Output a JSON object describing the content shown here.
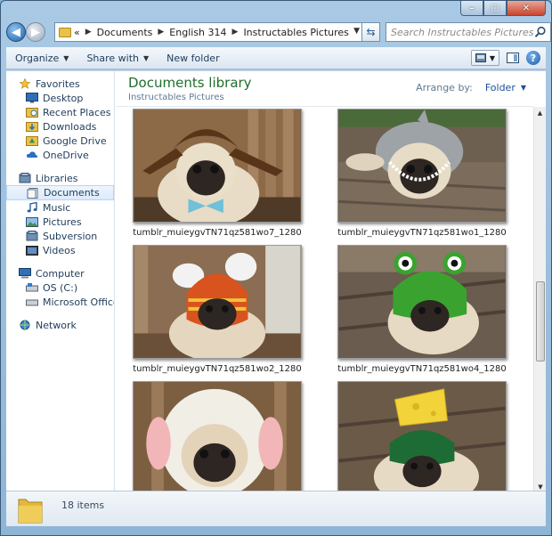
{
  "window": {
    "caption": {
      "minimize": "–",
      "maximize": "▢",
      "close": "✕"
    }
  },
  "address_bar": {
    "overflow_chevron": "«",
    "breadcrumbs": [
      "Documents",
      "English 314",
      "Instructables Pictures"
    ],
    "search_placeholder": "Search Instructables Pictures"
  },
  "toolbar": {
    "organize": "Organize",
    "share_with": "Share with",
    "new_folder": "New folder"
  },
  "sidebar": {
    "favorites": {
      "label": "Favorites",
      "items": [
        "Desktop",
        "Recent Places",
        "Downloads",
        "Google Drive",
        "OneDrive"
      ]
    },
    "libraries": {
      "label": "Libraries",
      "items": [
        "Documents",
        "Music",
        "Pictures",
        "Subversion",
        "Videos"
      ],
      "selected": "Documents"
    },
    "computer": {
      "label": "Computer",
      "items": [
        "OS (C:)",
        "Microsoft Office Clic"
      ]
    },
    "network": {
      "label": "Network"
    }
  },
  "library": {
    "title": "Documents library",
    "subtitle": "Instructables Pictures",
    "arrange_by_label": "Arrange by:",
    "arrange_by_value": "Folder"
  },
  "files": [
    {
      "name": "tumblr_muieygvTN71qz581wo7_1280",
      "hat": "brown-dog-ears",
      "hat_color": "#5a3418"
    },
    {
      "name": "tumblr_muieygvTN71qz581wo1_1280",
      "hat": "shark",
      "hat_color": "#9ea3a8"
    },
    {
      "name": "tumblr_muieygvTN71qz581wo2_1280",
      "hat": "orange-pompom",
      "hat_color": "#d9531e"
    },
    {
      "name": "tumblr_muieygvTN71qz581wo4_1280",
      "hat": "frog",
      "hat_color": "#3aa32f"
    },
    {
      "name": "",
      "hat": "lamb",
      "hat_color": "#f1eee6"
    },
    {
      "name": "",
      "hat": "cheese-mouse",
      "hat_color": "#1d6b35"
    }
  ],
  "details": {
    "item_count": "18 items"
  },
  "colors": {
    "library_title": "#1e6f2b",
    "selection": "#dbeafb",
    "window_chrome": "#a9c9e4"
  }
}
